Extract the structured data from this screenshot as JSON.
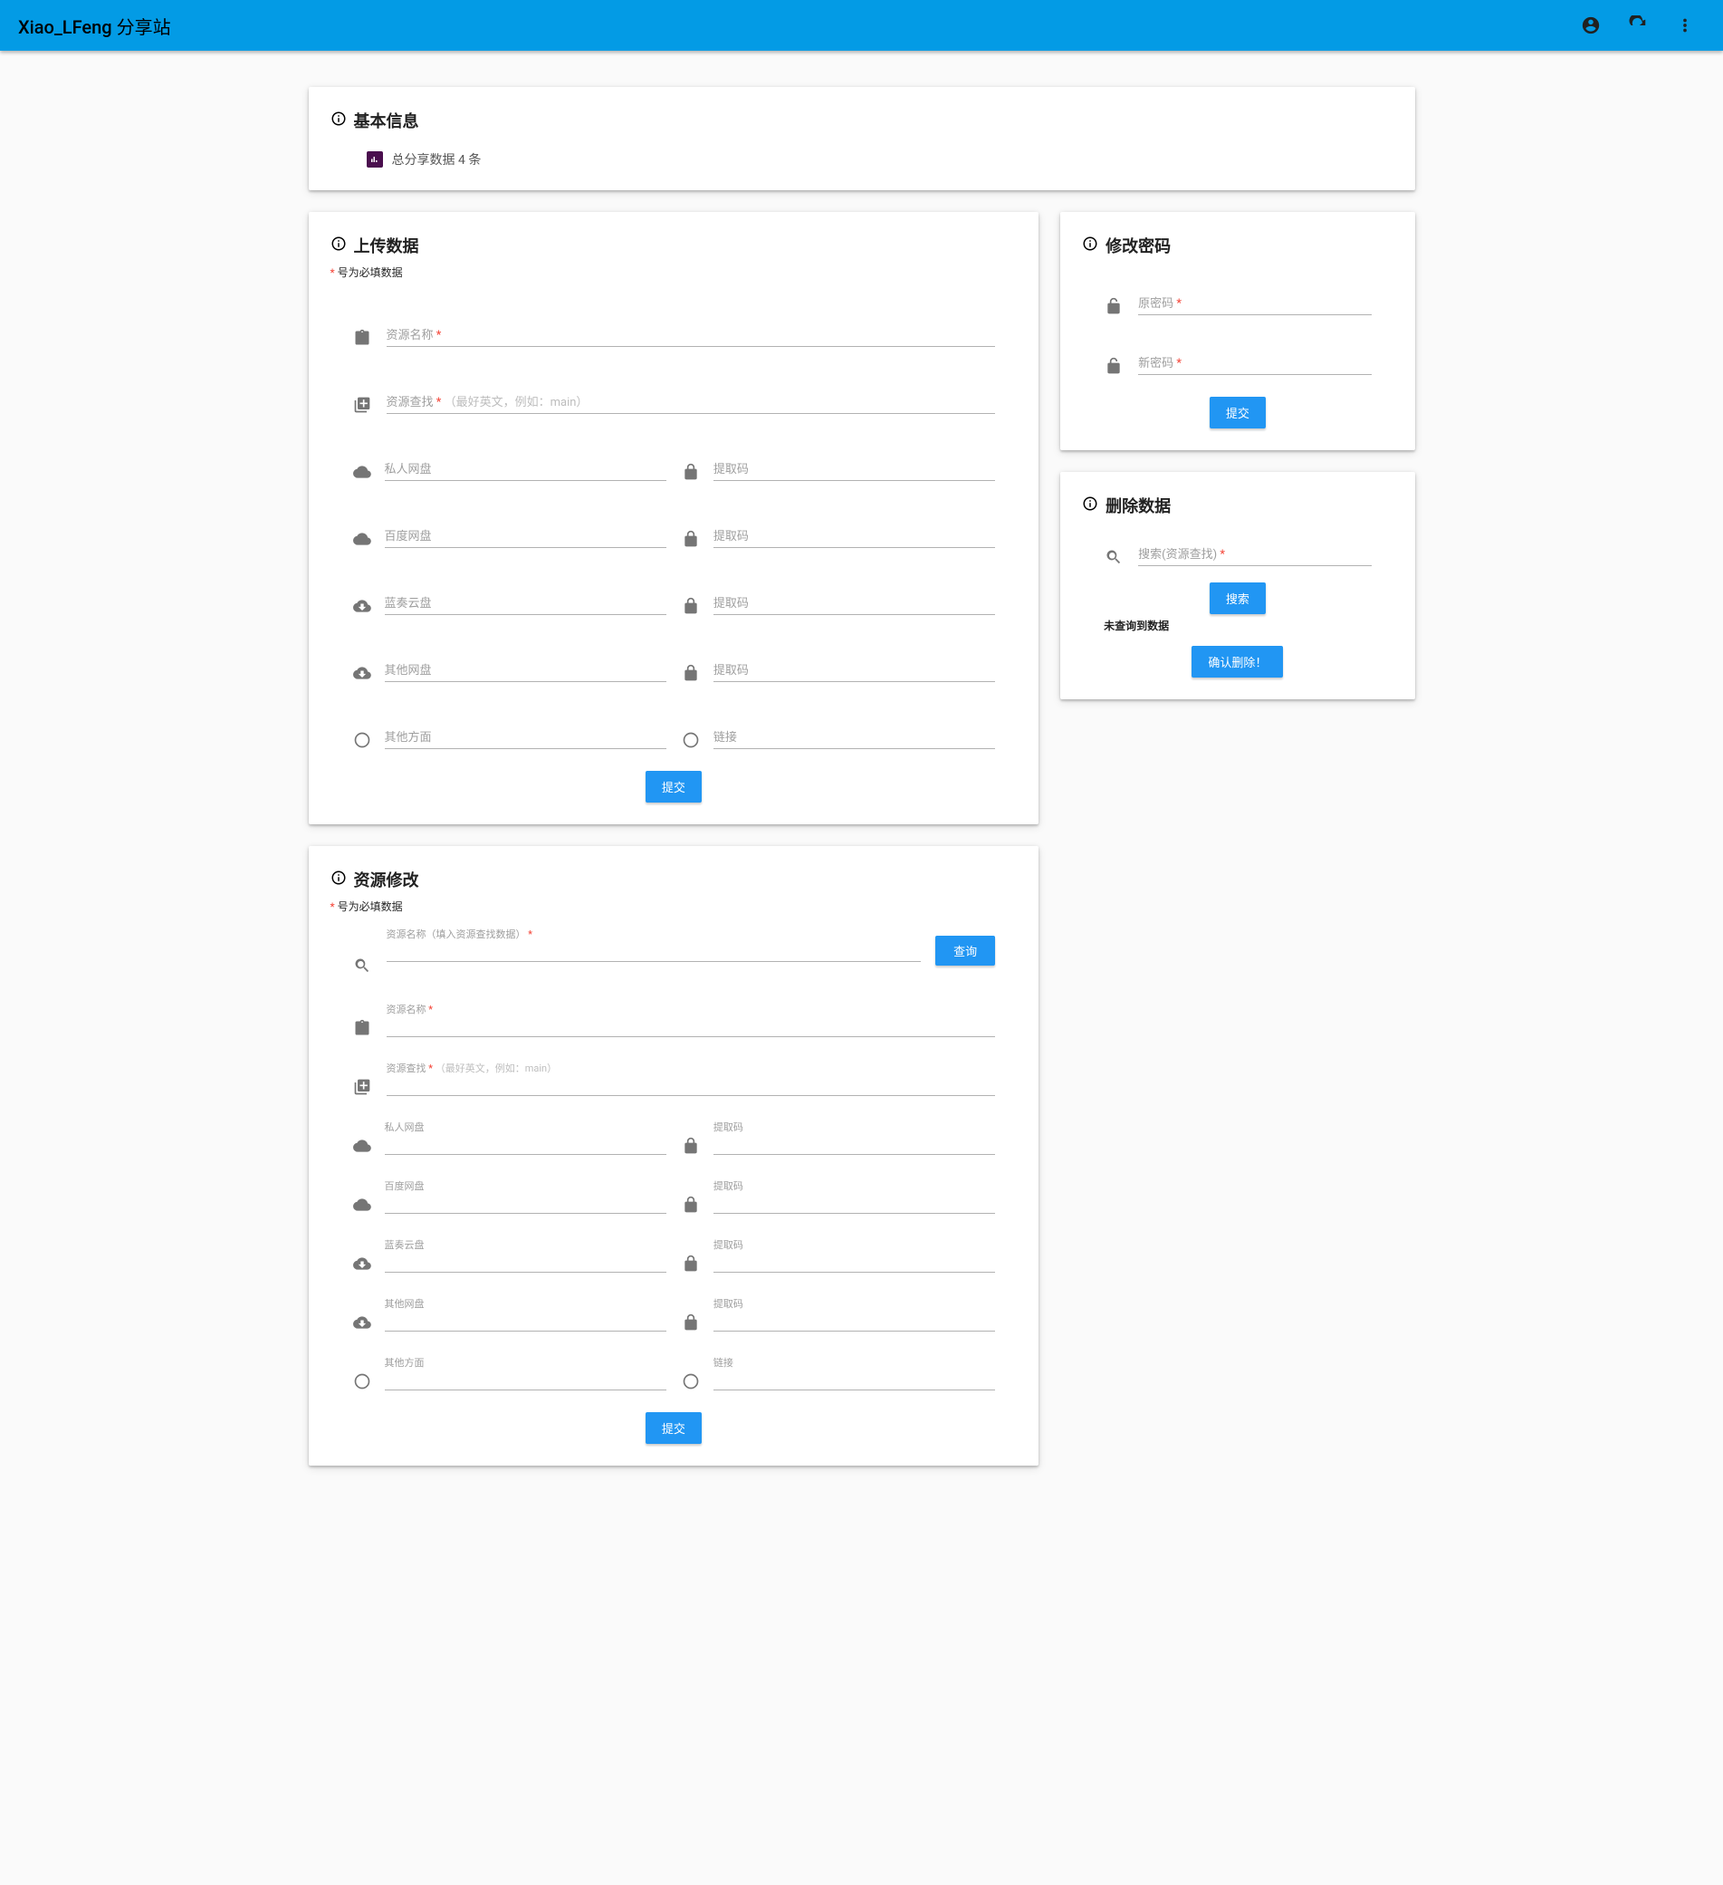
{
  "appbar": {
    "title": "Xiao_LFeng 分享站",
    "icons": [
      "account",
      "refresh",
      "more"
    ]
  },
  "basic_info": {
    "title": "基本信息",
    "summary": "总分享数据 4 条"
  },
  "upload": {
    "title": "上传数据",
    "required_note": "号为必填数据",
    "fields": {
      "name_label": "资源名称",
      "slug_label": "资源查找",
      "slug_hint": "（最好英文，例如：main）",
      "private_cloud": "私人网盘",
      "baidu_cloud": "百度网盘",
      "lanzou_cloud": "蓝奏云盘",
      "other_cloud": "其他网盘",
      "extract_code": "提取码",
      "other_aspect": "其他方面",
      "link": "链接"
    },
    "submit": "提交"
  },
  "change_password": {
    "title": "修改密码",
    "old_pw": "原密码",
    "new_pw": "新密码",
    "submit": "提交"
  },
  "delete_data": {
    "title": "删除数据",
    "search_label": "搜索(资源查找)",
    "search_btn": "搜索",
    "no_result": "未查询到数据",
    "confirm": "确认删除！"
  },
  "modify": {
    "title": "资源修改",
    "required_note": "号为必填数据",
    "search_label": "资源名称（填入资源查找数据）",
    "search_btn": "查询",
    "fields": {
      "name_label": "资源名称",
      "slug_label": "资源查找",
      "slug_hint": "（最好英文，例如：main）",
      "private_cloud": "私人网盘",
      "baidu_cloud": "百度网盘",
      "lanzou_cloud": "蓝奏云盘",
      "other_cloud": "其他网盘",
      "extract_code": "提取码",
      "other_aspect": "其他方面",
      "link": "链接"
    },
    "submit": "提交"
  }
}
